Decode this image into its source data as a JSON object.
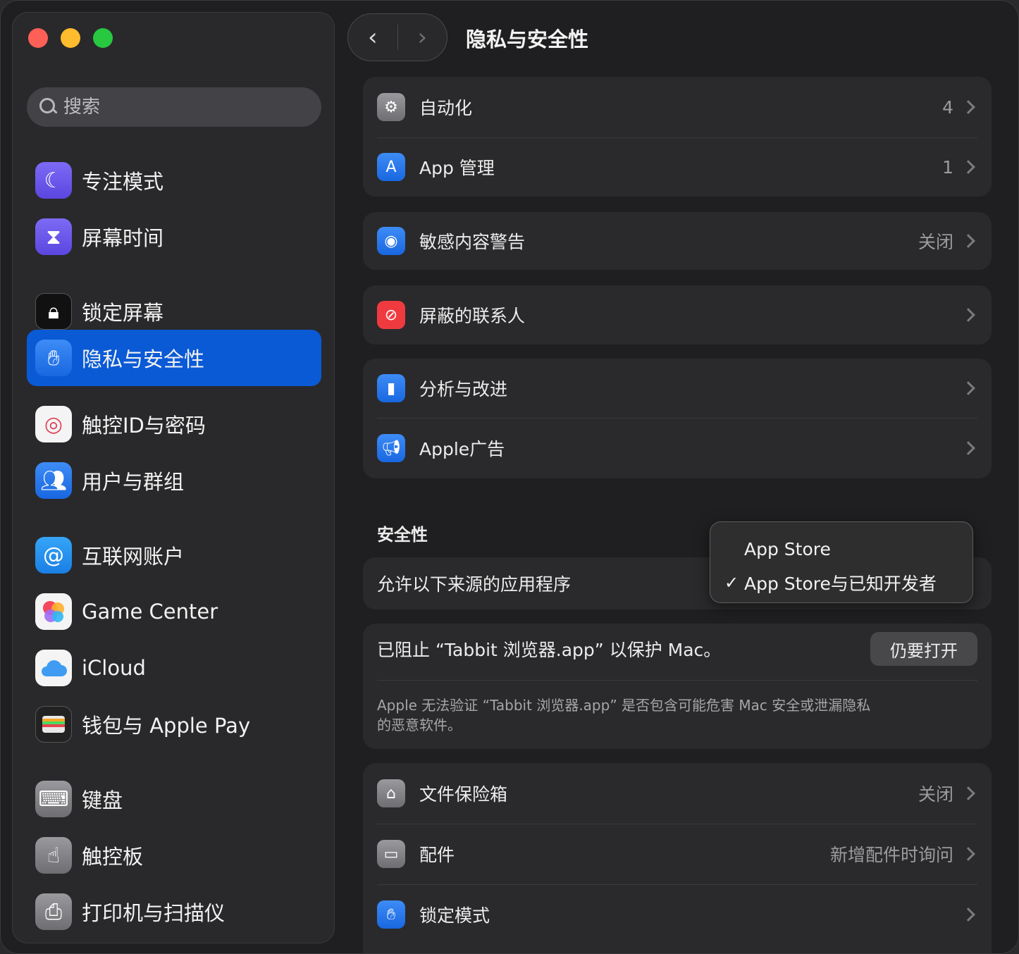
{
  "window": {
    "title": "隐私与安全性"
  },
  "sidebar": {
    "search_placeholder": "搜索",
    "items": [
      {
        "label": "专注模式",
        "icon": "moon-icon"
      },
      {
        "label": "屏幕时间",
        "icon": "hourglass-icon"
      },
      {
        "label": "锁定屏幕",
        "icon": "lock-screen-icon"
      },
      {
        "label": "隐私与安全性",
        "icon": "hand-icon",
        "active": true
      },
      {
        "label": "触控ID与密码",
        "icon": "fingerprint-icon"
      },
      {
        "label": "用户与群组",
        "icon": "users-icon"
      },
      {
        "label": "互联网账户",
        "icon": "at-icon"
      },
      {
        "label": "Game Center",
        "icon": "game-center-icon"
      },
      {
        "label": "iCloud",
        "icon": "cloud-icon"
      },
      {
        "label": "钱包与 Apple Pay",
        "icon": "wallet-icon"
      },
      {
        "label": "键盘",
        "icon": "keyboard-icon"
      },
      {
        "label": "触控板",
        "icon": "trackpad-icon"
      },
      {
        "label": "打印机与扫描仪",
        "icon": "printer-icon"
      }
    ]
  },
  "main": {
    "title": "隐私与安全性",
    "group1": [
      {
        "label": "自动化",
        "value": "4",
        "icon": "gears-icon"
      },
      {
        "label": "App 管理",
        "value": "1",
        "icon": "app-store-icon"
      }
    ],
    "sensitive": {
      "label": "敏感内容警告",
      "value": "关闭",
      "icon": "eye-warning-icon"
    },
    "blocked": {
      "label": "屏蔽的联系人",
      "icon": "blocked-icon"
    },
    "group_analytics": [
      {
        "label": "分析与改进",
        "icon": "chart-icon"
      },
      {
        "label": "Apple广告",
        "icon": "megaphone-icon"
      }
    ],
    "security": {
      "title": "安全性",
      "allow_label": "允许以下来源的应用程序",
      "popup_options": [
        "App Store",
        "App Store与已知开发者"
      ],
      "popup_selected_index": 1,
      "blocked_message": "已阻止 “Tabbit 浏览器.app” 以保护 Mac。",
      "open_anyway": "仍要打开",
      "warning_desc": "Apple 无法验证 “Tabbit 浏览器.app” 是否包含可能危害 Mac 安全或泄漏隐私的恶意软件。"
    },
    "group_bottom": [
      {
        "label": "文件保险箱",
        "value": "关闭",
        "icon": "vault-icon"
      },
      {
        "label": "配件",
        "value": "新增配件时询问",
        "icon": "accessory-icon"
      },
      {
        "label": "锁定模式",
        "value": "",
        "icon": "hand-icon"
      }
    ]
  },
  "colors": {
    "accent": "#0a5ad6",
    "background": "#1f1f21",
    "card": "#2a2a2c"
  }
}
